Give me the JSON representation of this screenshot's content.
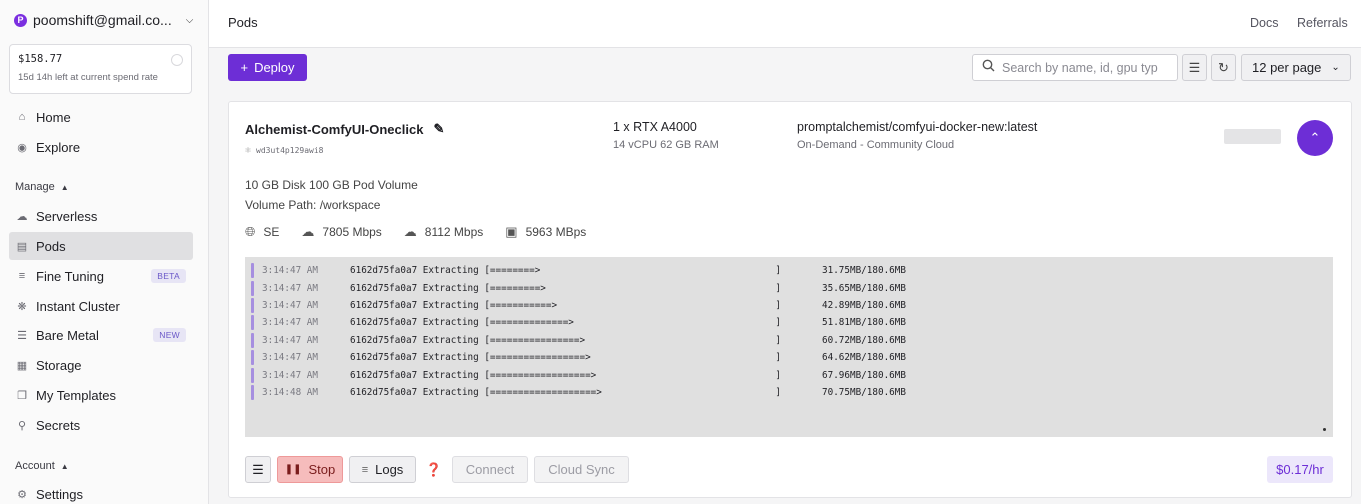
{
  "account": {
    "email": "poomshift@gmail.co...",
    "initial": "P"
  },
  "balance": {
    "amount": "$158.77",
    "remaining": "15d 14h left at current spend rate"
  },
  "nav": {
    "home": "Home",
    "explore": "Explore",
    "manage_label": "Manage",
    "serverless": "Serverless",
    "pods": "Pods",
    "fine_tuning": "Fine Tuning",
    "fine_tuning_badge": "BETA",
    "instant_cluster": "Instant Cluster",
    "bare_metal": "Bare Metal",
    "bare_metal_badge": "NEW",
    "storage": "Storage",
    "my_templates": "My Templates",
    "secrets": "Secrets",
    "account_label": "Account",
    "settings": "Settings"
  },
  "header": {
    "title": "Pods",
    "docs": "Docs",
    "referrals": "Referrals"
  },
  "toolbar": {
    "deploy_label": "Deploy",
    "search_placeholder": "Search by name, id, gpu typ",
    "per_page": "12 per page"
  },
  "pod": {
    "name": "Alchemist-ComfyUI-Oneclick",
    "id": "wd3ut4p129awi8",
    "gpu": "1 x RTX A4000",
    "gpu_specs": "14 vCPU 62 GB RAM",
    "image": "promptalchemist/comfyui-docker-new:latest",
    "image_sub": "On-Demand - Community Cloud",
    "disk": "10 GB Disk  100 GB Pod Volume",
    "volume_path": "Volume Path: /workspace",
    "region": "SE",
    "download": "7805 Mbps",
    "upload": "8112 Mbps",
    "disk_speed": "5963 MBps",
    "cost": "$0.17/hr"
  },
  "logs": [
    {
      "time": "3:14:47 AM",
      "msg": "6162d75fa0a7 Extracting [========>                                          ]",
      "size": "31.75MB/180.6MB"
    },
    {
      "time": "3:14:47 AM",
      "msg": "6162d75fa0a7 Extracting [=========>                                         ]",
      "size": "35.65MB/180.6MB"
    },
    {
      "time": "3:14:47 AM",
      "msg": "6162d75fa0a7 Extracting [===========>                                       ]",
      "size": "42.89MB/180.6MB"
    },
    {
      "time": "3:14:47 AM",
      "msg": "6162d75fa0a7 Extracting [==============>                                    ]",
      "size": "51.81MB/180.6MB"
    },
    {
      "time": "3:14:47 AM",
      "msg": "6162d75fa0a7 Extracting [================>                                  ]",
      "size": "60.72MB/180.6MB"
    },
    {
      "time": "3:14:47 AM",
      "msg": "6162d75fa0a7 Extracting [=================>                                 ]",
      "size": "64.62MB/180.6MB"
    },
    {
      "time": "3:14:47 AM",
      "msg": "6162d75fa0a7 Extracting [==================>                                ]",
      "size": "67.96MB/180.6MB"
    },
    {
      "time": "3:14:48 AM",
      "msg": "6162d75fa0a7 Extracting [===================>                               ]",
      "size": "70.75MB/180.6MB"
    }
  ],
  "actions": {
    "stop": "Stop",
    "logs": "Logs",
    "connect": "Connect",
    "cloud_sync": "Cloud Sync"
  }
}
